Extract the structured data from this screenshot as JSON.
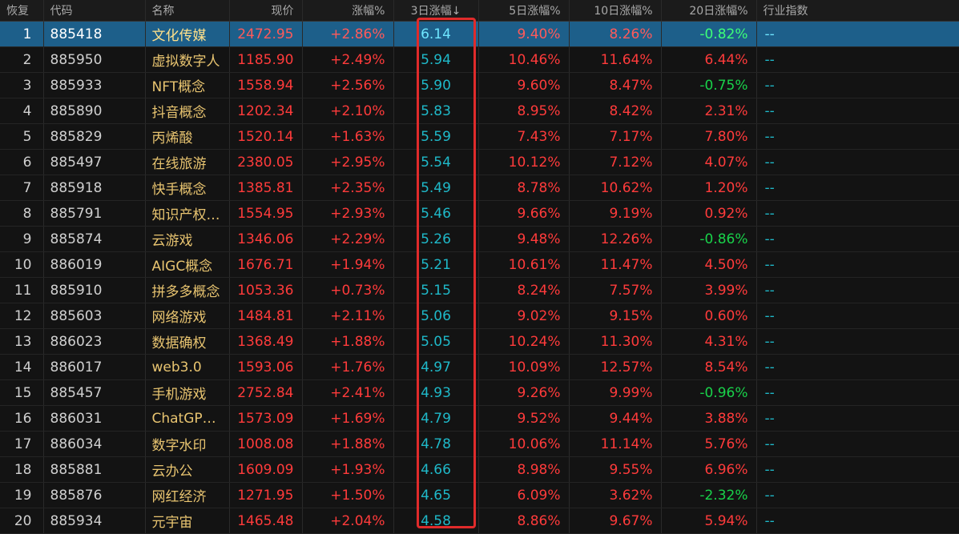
{
  "headers": {
    "restore": "恢复",
    "code": "代码",
    "name": "名称",
    "price": "现价",
    "change": "涨幅%",
    "d3": "3日涨幅↓",
    "d5": "5日涨幅%",
    "d10": "10日涨幅%",
    "d20": "20日涨幅%",
    "industry": "行业指数"
  },
  "colors": {
    "up": "#ff3b3b",
    "down": "#19d24a",
    "name": "#e8c470",
    "cyan": "#1fb9c9",
    "selected_row": "#1d5f8a",
    "highlight_box": "#e02b2b"
  },
  "selected_row": 1,
  "rows": [
    {
      "idx": "1",
      "code": "885418",
      "name": "文化传媒",
      "price": "2472.95",
      "change": "+2.86%",
      "d3": "6.14",
      "d5": "9.40%",
      "d10": "8.26%",
      "d20": "-0.82%",
      "industry": "--"
    },
    {
      "idx": "2",
      "code": "885950",
      "name": "虚拟数字人",
      "price": "1185.90",
      "change": "+2.49%",
      "d3": "5.94",
      "d5": "10.46%",
      "d10": "11.64%",
      "d20": "6.44%",
      "industry": "--"
    },
    {
      "idx": "3",
      "code": "885933",
      "name": "NFT概念",
      "price": "1558.94",
      "change": "+2.56%",
      "d3": "5.90",
      "d5": "9.60%",
      "d10": "8.47%",
      "d20": "-0.75%",
      "industry": "--"
    },
    {
      "idx": "4",
      "code": "885890",
      "name": "抖音概念",
      "price": "1202.34",
      "change": "+2.10%",
      "d3": "5.83",
      "d5": "8.95%",
      "d10": "8.42%",
      "d20": "2.31%",
      "industry": "--"
    },
    {
      "idx": "5",
      "code": "885829",
      "name": "丙烯酸",
      "price": "1520.14",
      "change": "+1.63%",
      "d3": "5.59",
      "d5": "7.43%",
      "d10": "7.17%",
      "d20": "7.80%",
      "industry": "--"
    },
    {
      "idx": "6",
      "code": "885497",
      "name": "在线旅游",
      "price": "2380.05",
      "change": "+2.95%",
      "d3": "5.54",
      "d5": "10.12%",
      "d10": "7.12%",
      "d20": "4.07%",
      "industry": "--"
    },
    {
      "idx": "7",
      "code": "885918",
      "name": "快手概念",
      "price": "1385.81",
      "change": "+2.35%",
      "d3": "5.49",
      "d5": "8.78%",
      "d10": "10.62%",
      "d20": "1.20%",
      "industry": "--"
    },
    {
      "idx": "8",
      "code": "885791",
      "name": "知识产权…",
      "price": "1554.95",
      "change": "+2.93%",
      "d3": "5.46",
      "d5": "9.66%",
      "d10": "9.19%",
      "d20": "0.92%",
      "industry": "--"
    },
    {
      "idx": "9",
      "code": "885874",
      "name": "云游戏",
      "price": "1346.06",
      "change": "+2.29%",
      "d3": "5.26",
      "d5": "9.48%",
      "d10": "12.26%",
      "d20": "-0.86%",
      "industry": "--"
    },
    {
      "idx": "10",
      "code": "886019",
      "name": "AIGC概念",
      "price": "1676.71",
      "change": "+1.94%",
      "d3": "5.21",
      "d5": "10.61%",
      "d10": "11.47%",
      "d20": "4.50%",
      "industry": "--"
    },
    {
      "idx": "11",
      "code": "885910",
      "name": "拼多多概念",
      "price": "1053.36",
      "change": "+0.73%",
      "d3": "5.15",
      "d5": "8.24%",
      "d10": "7.57%",
      "d20": "3.99%",
      "industry": "--"
    },
    {
      "idx": "12",
      "code": "885603",
      "name": "网络游戏",
      "price": "1484.81",
      "change": "+2.11%",
      "d3": "5.06",
      "d5": "9.02%",
      "d10": "9.15%",
      "d20": "0.60%",
      "industry": "--"
    },
    {
      "idx": "13",
      "code": "886023",
      "name": "数据确权",
      "price": "1368.49",
      "change": "+1.88%",
      "d3": "5.05",
      "d5": "10.24%",
      "d10": "11.30%",
      "d20": "4.31%",
      "industry": "--"
    },
    {
      "idx": "14",
      "code": "886017",
      "name": "web3.0",
      "price": "1593.06",
      "change": "+1.76%",
      "d3": "4.97",
      "d5": "10.09%",
      "d10": "12.57%",
      "d20": "8.54%",
      "industry": "--"
    },
    {
      "idx": "15",
      "code": "885457",
      "name": "手机游戏",
      "price": "2752.84",
      "change": "+2.41%",
      "d3": "4.93",
      "d5": "9.26%",
      "d10": "9.99%",
      "d20": "-0.96%",
      "industry": "--"
    },
    {
      "idx": "16",
      "code": "886031",
      "name": "ChatGPT…",
      "price": "1573.09",
      "change": "+1.69%",
      "d3": "4.79",
      "d5": "9.52%",
      "d10": "9.44%",
      "d20": "3.88%",
      "industry": "--"
    },
    {
      "idx": "17",
      "code": "886034",
      "name": "数字水印",
      "price": "1008.08",
      "change": "+1.88%",
      "d3": "4.78",
      "d5": "10.06%",
      "d10": "11.14%",
      "d20": "5.76%",
      "industry": "--"
    },
    {
      "idx": "18",
      "code": "885881",
      "name": "云办公",
      "price": "1609.09",
      "change": "+1.93%",
      "d3": "4.66",
      "d5": "8.98%",
      "d10": "9.55%",
      "d20": "6.96%",
      "industry": "--"
    },
    {
      "idx": "19",
      "code": "885876",
      "name": "网红经济",
      "price": "1271.95",
      "change": "+1.50%",
      "d3": "4.65",
      "d5": "6.09%",
      "d10": "3.62%",
      "d20": "-2.32%",
      "industry": "--"
    },
    {
      "idx": "20",
      "code": "885934",
      "name": "元宇宙",
      "price": "1465.48",
      "change": "+2.04%",
      "d3": "4.58",
      "d5": "8.86%",
      "d10": "9.67%",
      "d20": "5.94%",
      "industry": "--"
    }
  ]
}
